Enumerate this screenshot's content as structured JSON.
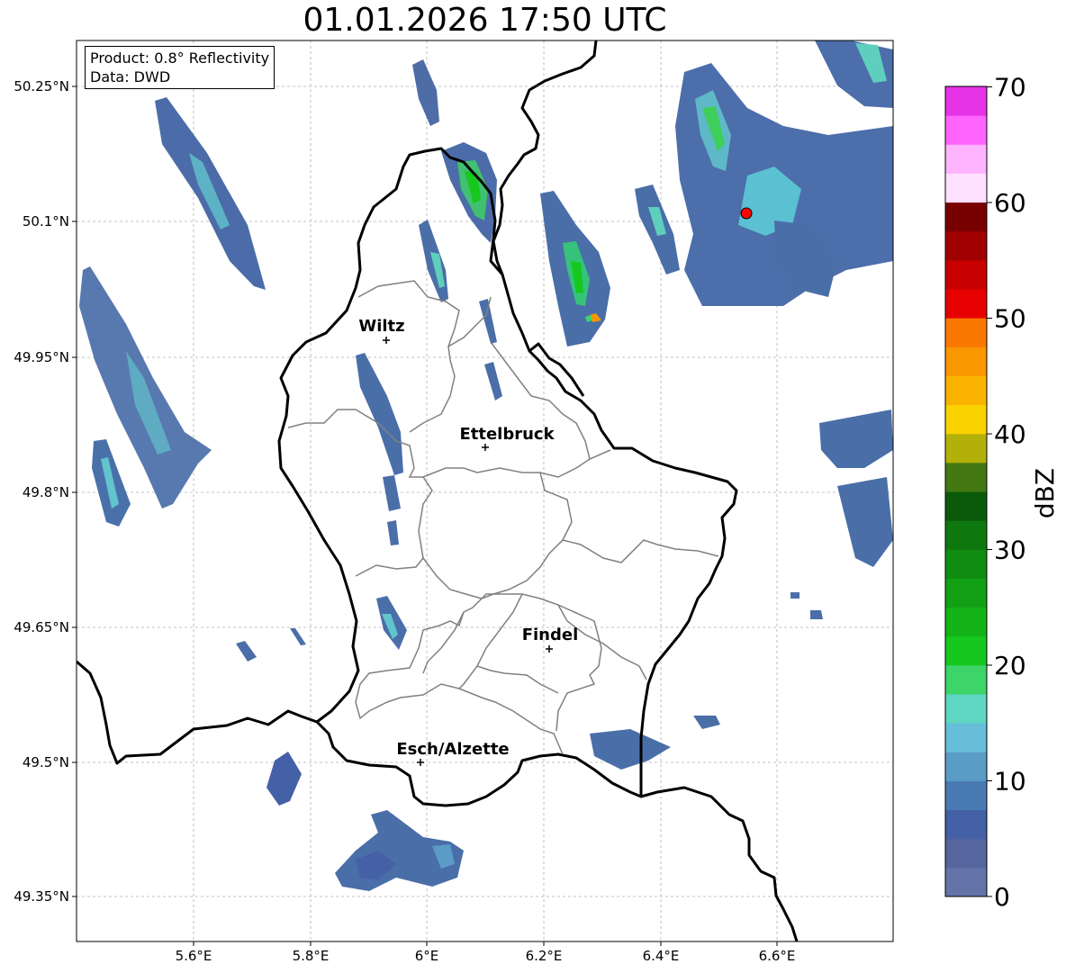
{
  "title": "01.01.2026 17:50 UTC",
  "info": {
    "product": "Product: 0.8° Reflectivity",
    "source": "Data: DWD"
  },
  "axes": {
    "lat_labels": [
      "50.25°N",
      "50.1°N",
      "49.95°N",
      "49.8°N",
      "49.65°N",
      "49.5°N",
      "49.35°N"
    ],
    "lon_labels": [
      "5.6°E",
      "5.8°E",
      "6°E",
      "6.2°E",
      "6.4°E",
      "6.6°E"
    ]
  },
  "cities": [
    {
      "name": "Wiltz",
      "lon": 5.93,
      "lat": 49.97
    },
    {
      "name": "Ettelbruck",
      "lon": 6.1,
      "lat": 49.85
    },
    {
      "name": "Findel",
      "lon": 6.21,
      "lat": 49.63
    },
    {
      "name": "Esch/Alzette",
      "lon": 5.99,
      "lat": 49.5
    }
  ],
  "radar_site": {
    "lon": 6.55,
    "lat": 50.11
  },
  "colorbar": {
    "label": "dBZ",
    "ticks": [
      "0",
      "10",
      "20",
      "30",
      "40",
      "50",
      "60",
      "70"
    ],
    "min": 0,
    "max": 70,
    "colors": [
      "#6474a8",
      "#55669e",
      "#4460a6",
      "#4a7ab4",
      "#5a9cc6",
      "#66bed8",
      "#5ed6c2",
      "#3dd46a",
      "#15c81e",
      "#14b418",
      "#12a014",
      "#108c10",
      "#0e780e",
      "#0a5a0a",
      "#447812",
      "#b4b00a",
      "#fad200",
      "#fab400",
      "#fa9600",
      "#fa7800",
      "#e60000",
      "#c80000",
      "#a00000",
      "#780000",
      "#ffe0ff",
      "#ffb4ff",
      "#ff64ff",
      "#e632e6"
    ]
  }
}
